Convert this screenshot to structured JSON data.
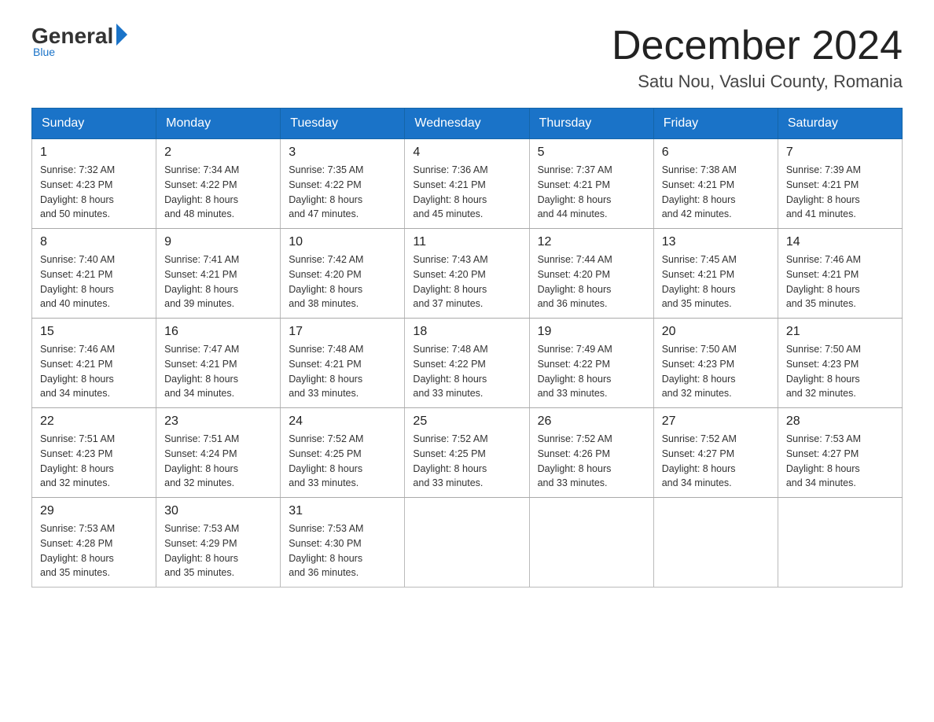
{
  "header": {
    "logo": {
      "general_text": "General",
      "blue_text": "Blue",
      "tagline": "Blue"
    },
    "title": "December 2024",
    "subtitle": "Satu Nou, Vaslui County, Romania"
  },
  "calendar": {
    "weekdays": [
      "Sunday",
      "Monday",
      "Tuesday",
      "Wednesday",
      "Thursday",
      "Friday",
      "Saturday"
    ],
    "rows": [
      [
        {
          "day": "1",
          "sunrise": "7:32 AM",
          "sunset": "4:23 PM",
          "daylight": "8 hours and 50 minutes."
        },
        {
          "day": "2",
          "sunrise": "7:34 AM",
          "sunset": "4:22 PM",
          "daylight": "8 hours and 48 minutes."
        },
        {
          "day": "3",
          "sunrise": "7:35 AM",
          "sunset": "4:22 PM",
          "daylight": "8 hours and 47 minutes."
        },
        {
          "day": "4",
          "sunrise": "7:36 AM",
          "sunset": "4:21 PM",
          "daylight": "8 hours and 45 minutes."
        },
        {
          "day": "5",
          "sunrise": "7:37 AM",
          "sunset": "4:21 PM",
          "daylight": "8 hours and 44 minutes."
        },
        {
          "day": "6",
          "sunrise": "7:38 AM",
          "sunset": "4:21 PM",
          "daylight": "8 hours and 42 minutes."
        },
        {
          "day": "7",
          "sunrise": "7:39 AM",
          "sunset": "4:21 PM",
          "daylight": "8 hours and 41 minutes."
        }
      ],
      [
        {
          "day": "8",
          "sunrise": "7:40 AM",
          "sunset": "4:21 PM",
          "daylight": "8 hours and 40 minutes."
        },
        {
          "day": "9",
          "sunrise": "7:41 AM",
          "sunset": "4:21 PM",
          "daylight": "8 hours and 39 minutes."
        },
        {
          "day": "10",
          "sunrise": "7:42 AM",
          "sunset": "4:20 PM",
          "daylight": "8 hours and 38 minutes."
        },
        {
          "day": "11",
          "sunrise": "7:43 AM",
          "sunset": "4:20 PM",
          "daylight": "8 hours and 37 minutes."
        },
        {
          "day": "12",
          "sunrise": "7:44 AM",
          "sunset": "4:20 PM",
          "daylight": "8 hours and 36 minutes."
        },
        {
          "day": "13",
          "sunrise": "7:45 AM",
          "sunset": "4:21 PM",
          "daylight": "8 hours and 35 minutes."
        },
        {
          "day": "14",
          "sunrise": "7:46 AM",
          "sunset": "4:21 PM",
          "daylight": "8 hours and 35 minutes."
        }
      ],
      [
        {
          "day": "15",
          "sunrise": "7:46 AM",
          "sunset": "4:21 PM",
          "daylight": "8 hours and 34 minutes."
        },
        {
          "day": "16",
          "sunrise": "7:47 AM",
          "sunset": "4:21 PM",
          "daylight": "8 hours and 34 minutes."
        },
        {
          "day": "17",
          "sunrise": "7:48 AM",
          "sunset": "4:21 PM",
          "daylight": "8 hours and 33 minutes."
        },
        {
          "day": "18",
          "sunrise": "7:48 AM",
          "sunset": "4:22 PM",
          "daylight": "8 hours and 33 minutes."
        },
        {
          "day": "19",
          "sunrise": "7:49 AM",
          "sunset": "4:22 PM",
          "daylight": "8 hours and 33 minutes."
        },
        {
          "day": "20",
          "sunrise": "7:50 AM",
          "sunset": "4:23 PM",
          "daylight": "8 hours and 32 minutes."
        },
        {
          "day": "21",
          "sunrise": "7:50 AM",
          "sunset": "4:23 PM",
          "daylight": "8 hours and 32 minutes."
        }
      ],
      [
        {
          "day": "22",
          "sunrise": "7:51 AM",
          "sunset": "4:23 PM",
          "daylight": "8 hours and 32 minutes."
        },
        {
          "day": "23",
          "sunrise": "7:51 AM",
          "sunset": "4:24 PM",
          "daylight": "8 hours and 32 minutes."
        },
        {
          "day": "24",
          "sunrise": "7:52 AM",
          "sunset": "4:25 PM",
          "daylight": "8 hours and 33 minutes."
        },
        {
          "day": "25",
          "sunrise": "7:52 AM",
          "sunset": "4:25 PM",
          "daylight": "8 hours and 33 minutes."
        },
        {
          "day": "26",
          "sunrise": "7:52 AM",
          "sunset": "4:26 PM",
          "daylight": "8 hours and 33 minutes."
        },
        {
          "day": "27",
          "sunrise": "7:52 AM",
          "sunset": "4:27 PM",
          "daylight": "8 hours and 34 minutes."
        },
        {
          "day": "28",
          "sunrise": "7:53 AM",
          "sunset": "4:27 PM",
          "daylight": "8 hours and 34 minutes."
        }
      ],
      [
        {
          "day": "29",
          "sunrise": "7:53 AM",
          "sunset": "4:28 PM",
          "daylight": "8 hours and 35 minutes."
        },
        {
          "day": "30",
          "sunrise": "7:53 AM",
          "sunset": "4:29 PM",
          "daylight": "8 hours and 35 minutes."
        },
        {
          "day": "31",
          "sunrise": "7:53 AM",
          "sunset": "4:30 PM",
          "daylight": "8 hours and 36 minutes."
        },
        null,
        null,
        null,
        null
      ]
    ]
  }
}
